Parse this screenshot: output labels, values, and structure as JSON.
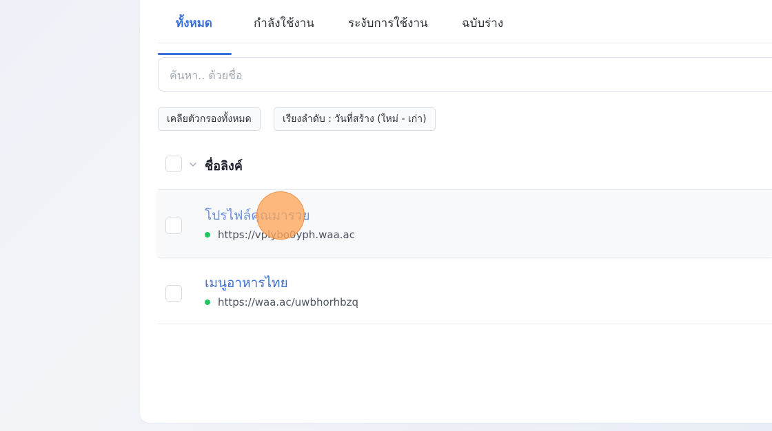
{
  "tabs": [
    {
      "label": "ทั้งหมด",
      "active": true
    },
    {
      "label": "กำลังใช้งาน",
      "active": false
    },
    {
      "label": "ระงับการใช้งาน",
      "active": false
    },
    {
      "label": "ฉบับร่าง",
      "active": false
    }
  ],
  "search": {
    "placeholder": "ค้นหา.. ด้วยชื่อ",
    "value": ""
  },
  "filters": {
    "clear_label": "เคลียตัวกรองทั้งหมด",
    "sort_label": "เรียงลำดับ : วันที่สร้าง (ใหม่ - เก่า)"
  },
  "table": {
    "header": "ชื่อลิงค์",
    "rows": [
      {
        "title": "โปรไฟล์คุณมารวย",
        "url": "https://vplybo0yph.waa.ac",
        "status_color": "#22c55e"
      },
      {
        "title": "เมนูอาหารไทย",
        "url": "https://waa.ac/uwbhorhbzq",
        "status_color": "#22c55e"
      }
    ]
  },
  "colors": {
    "accent": "#3b6fd8",
    "status_active": "#22c55e"
  }
}
